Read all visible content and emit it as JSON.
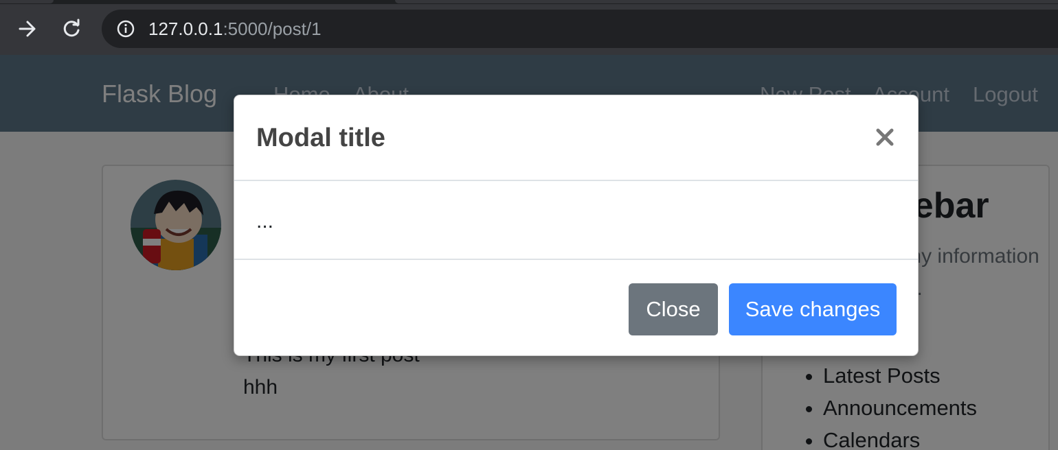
{
  "browser": {
    "url_host": "127.0.0.1",
    "url_rest": ":5000/post/1",
    "icons": [
      "forward-arrow-icon",
      "reload-icon",
      "info-icon"
    ]
  },
  "site": {
    "brand": "Flask Blog",
    "nav_left": [
      "Home",
      "About"
    ],
    "nav_right": [
      "New Post",
      "Account",
      "Logout"
    ],
    "header_color": "#5f788a"
  },
  "post": {
    "content_lines": [
      "This is my first post",
      "hhh"
    ]
  },
  "sidebar": {
    "title": "Our Sidebar",
    "description": "You can put any information here you'd like.",
    "items": [
      "Latest Posts",
      "Announcements",
      "Calendars"
    ]
  },
  "modal": {
    "title": "Modal title",
    "body": "...",
    "close_label": "Close",
    "save_label": "Save changes",
    "close_icon": "close-icon",
    "colors": {
      "close_button": "#6c757d",
      "save_button": "#3b86ff"
    }
  }
}
